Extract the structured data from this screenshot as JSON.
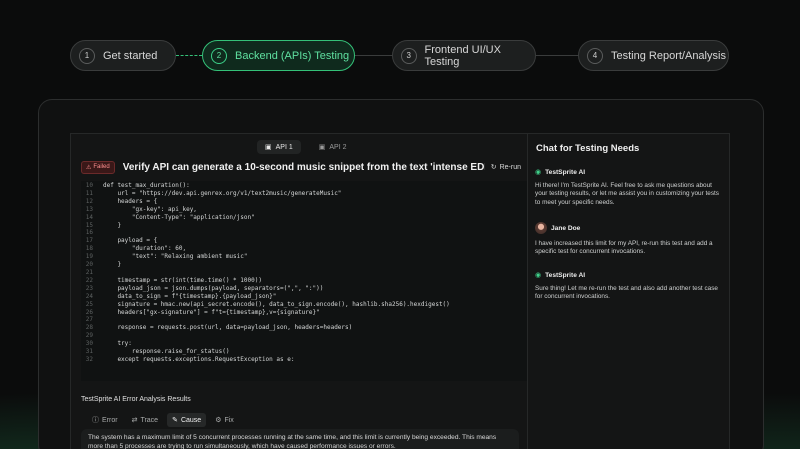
{
  "stepper": {
    "steps": [
      {
        "num": "1",
        "label": "Get started"
      },
      {
        "num": "2",
        "label": "Backend (APIs) Testing"
      },
      {
        "num": "3",
        "label": "Frontend UI/UX Testing"
      },
      {
        "num": "4",
        "label": "Testing Report/Analysis"
      }
    ],
    "active_index": 1
  },
  "editor": {
    "tabs": [
      "API 1",
      "API 2"
    ],
    "status_badge": "Failed",
    "title": "Verify API can generate a 10-second music snippet from the text 'intense EDM'",
    "rerun_label": "Re-run",
    "code_lines": [
      {
        "n": "10",
        "t": "def test_max_duration():"
      },
      {
        "n": "11",
        "t": "    url = \"https://dev.api.genrex.org/v1/text2music/generateMusic\""
      },
      {
        "n": "12",
        "t": "    headers = {"
      },
      {
        "n": "13",
        "t": "        \"gx-key\": api_key,"
      },
      {
        "n": "14",
        "t": "        \"Content-Type\": \"application/json\""
      },
      {
        "n": "15",
        "t": "    }"
      },
      {
        "n": "16",
        "t": ""
      },
      {
        "n": "17",
        "t": "    payload = {"
      },
      {
        "n": "18",
        "t": "        \"duration\": 60,"
      },
      {
        "n": "19",
        "t": "        \"text\": \"Relaxing ambient music\""
      },
      {
        "n": "20",
        "t": "    }"
      },
      {
        "n": "21",
        "t": ""
      },
      {
        "n": "22",
        "t": "    timestamp = str(int(time.time() * 1000))"
      },
      {
        "n": "23",
        "t": "    payload_json = json.dumps(payload, separators=(\",\", \":\"))"
      },
      {
        "n": "24",
        "t": "    data_to_sign = f\"{timestamp}.{payload_json}\""
      },
      {
        "n": "25",
        "t": "    signature = hmac.new(api_secret.encode(), data_to_sign.encode(), hashlib.sha256).hexdigest()"
      },
      {
        "n": "26",
        "t": "    headers[\"gx-signature\"] = f\"t={timestamp},v={signature}\""
      },
      {
        "n": "27",
        "t": ""
      },
      {
        "n": "28",
        "t": "    response = requests.post(url, data=payload_json, headers=headers)"
      },
      {
        "n": "29",
        "t": ""
      },
      {
        "n": "30",
        "t": "    try:"
      },
      {
        "n": "31",
        "t": "        response.raise_for_status()"
      },
      {
        "n": "32",
        "t": "    except requests.exceptions.RequestException as e:"
      }
    ]
  },
  "analysis": {
    "title": "TestSprite AI Error Analysis Results",
    "tabs": [
      "Error",
      "Trace",
      "Cause",
      "Fix"
    ],
    "active_tab": "Cause",
    "cause_text": "The system has a maximum limit of 5 concurrent processes running at the same time, and this limit is currently being exceeded. This means more than 5 processes are trying to run simultaneously, which have caused performance issues or errors."
  },
  "chat": {
    "title": "Chat for Testing Needs",
    "messages": [
      {
        "sender": "TestSprite AI",
        "kind": "bot",
        "text": "Hi there! I'm TestSprite AI. Feel free to ask me questions about your testing results, or let me assist you in customizing your tests to meet your specific needs."
      },
      {
        "sender": "Jane Doe",
        "kind": "user",
        "text": "I have increased this limit for my API, re-run this test and add a specific test for concurrent invocations."
      },
      {
        "sender": "TestSprite AI",
        "kind": "bot",
        "text": "Sure thing! Let me re-run the test and also add another test case for concurrent invocations."
      }
    ]
  },
  "colors": {
    "accent": "#34c178",
    "failed": "#ff8f8f",
    "background": "#0b0c0c"
  }
}
